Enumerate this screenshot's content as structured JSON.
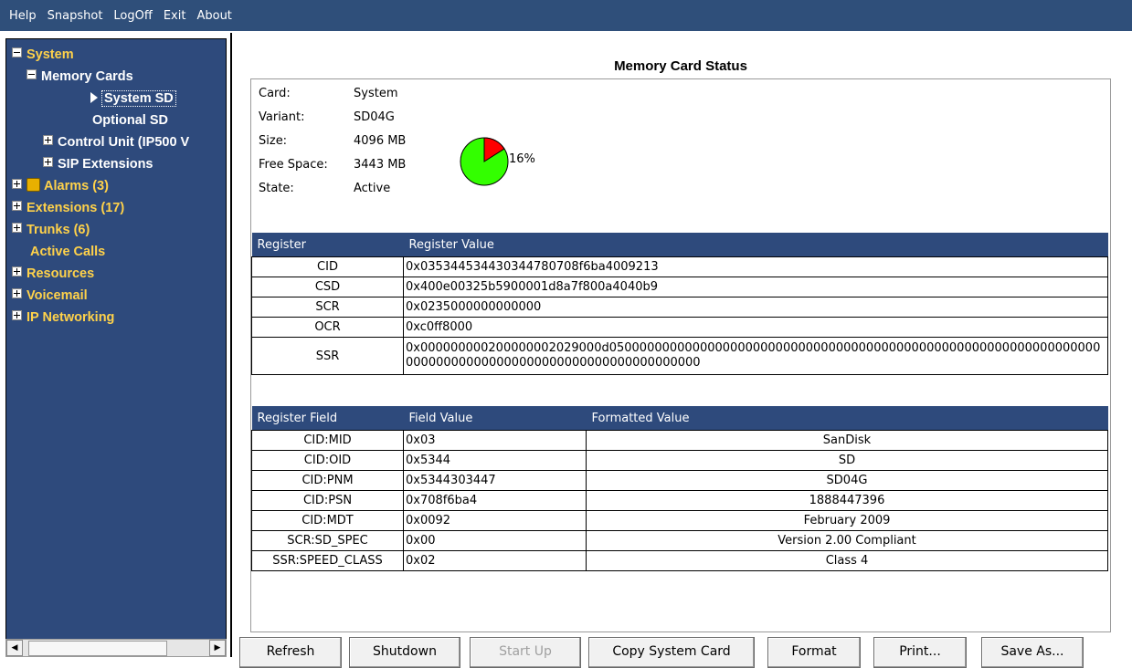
{
  "menu": {
    "items": [
      "Help",
      "Snapshot",
      "LogOff",
      "Exit",
      "About"
    ]
  },
  "tree": {
    "system": "System",
    "memory_cards": "Memory Cards",
    "system_sd": "System SD",
    "optional_sd": "Optional SD",
    "control_unit": "Control Unit (IP500 V",
    "sip_extensions": "SIP Extensions",
    "alarms": "Alarms (3)",
    "extensions": "Extensions (17)",
    "trunks": "Trunks (6)",
    "active_calls": "Active Calls",
    "resources": "Resources",
    "voicemail": "Voicemail",
    "ip_networking": "IP Networking"
  },
  "main": {
    "title": "Memory Card Status",
    "info": [
      {
        "label": "Card:",
        "value": "System"
      },
      {
        "label": "Variant:",
        "value": "SD04G"
      },
      {
        "label": "Size:",
        "value": "4096 MB"
      },
      {
        "label": "Free Space:",
        "value": "3443 MB"
      },
      {
        "label": "State:",
        "value": "Active"
      }
    ],
    "used_percent": "16%",
    "used_fraction": 0.16,
    "colors": {
      "used": "#ff0000",
      "free": "#33ff00",
      "header": "#2e4a7c"
    },
    "reg_headers": [
      "Register",
      "Register Value"
    ],
    "registers": [
      {
        "name": "CID",
        "value": "0x035344534430344780708f6ba4009213"
      },
      {
        "name": "CSD",
        "value": "0x400e00325b5900001d8a7f800a4040b9"
      },
      {
        "name": "SCR",
        "value": "0x0235000000000000"
      },
      {
        "name": "OCR",
        "value": "0xc0ff8000"
      },
      {
        "name": "SSR",
        "value": "0x000000000200000002029000d05000000000000000000000000000000000000000000000000000000000000000000000000000000000000000000000000000000"
      }
    ],
    "field_headers": [
      "Register Field",
      "Field Value",
      "Formatted Value"
    ],
    "fields": [
      {
        "field": "CID:MID",
        "value": "0x03",
        "formatted": "SanDisk"
      },
      {
        "field": "CID:OID",
        "value": "0x5344",
        "formatted": "SD"
      },
      {
        "field": "CID:PNM",
        "value": "0x5344303447",
        "formatted": "SD04G"
      },
      {
        "field": "CID:PSN",
        "value": "0x708f6ba4",
        "formatted": "1888447396"
      },
      {
        "field": "CID:MDT",
        "value": "0x0092",
        "formatted": "February 2009"
      },
      {
        "field": "SCR:SD_SPEC",
        "value": "0x00",
        "formatted": "Version 2.00 Compliant"
      },
      {
        "field": "SSR:SPEED_CLASS",
        "value": "0x02",
        "formatted": "Class 4"
      }
    ]
  },
  "buttons": {
    "refresh": "Refresh",
    "shutdown": "Shutdown",
    "start_up": "Start Up",
    "copy": "Copy System Card",
    "format": "Format",
    "print": "Print...",
    "save_as": "Save As..."
  }
}
